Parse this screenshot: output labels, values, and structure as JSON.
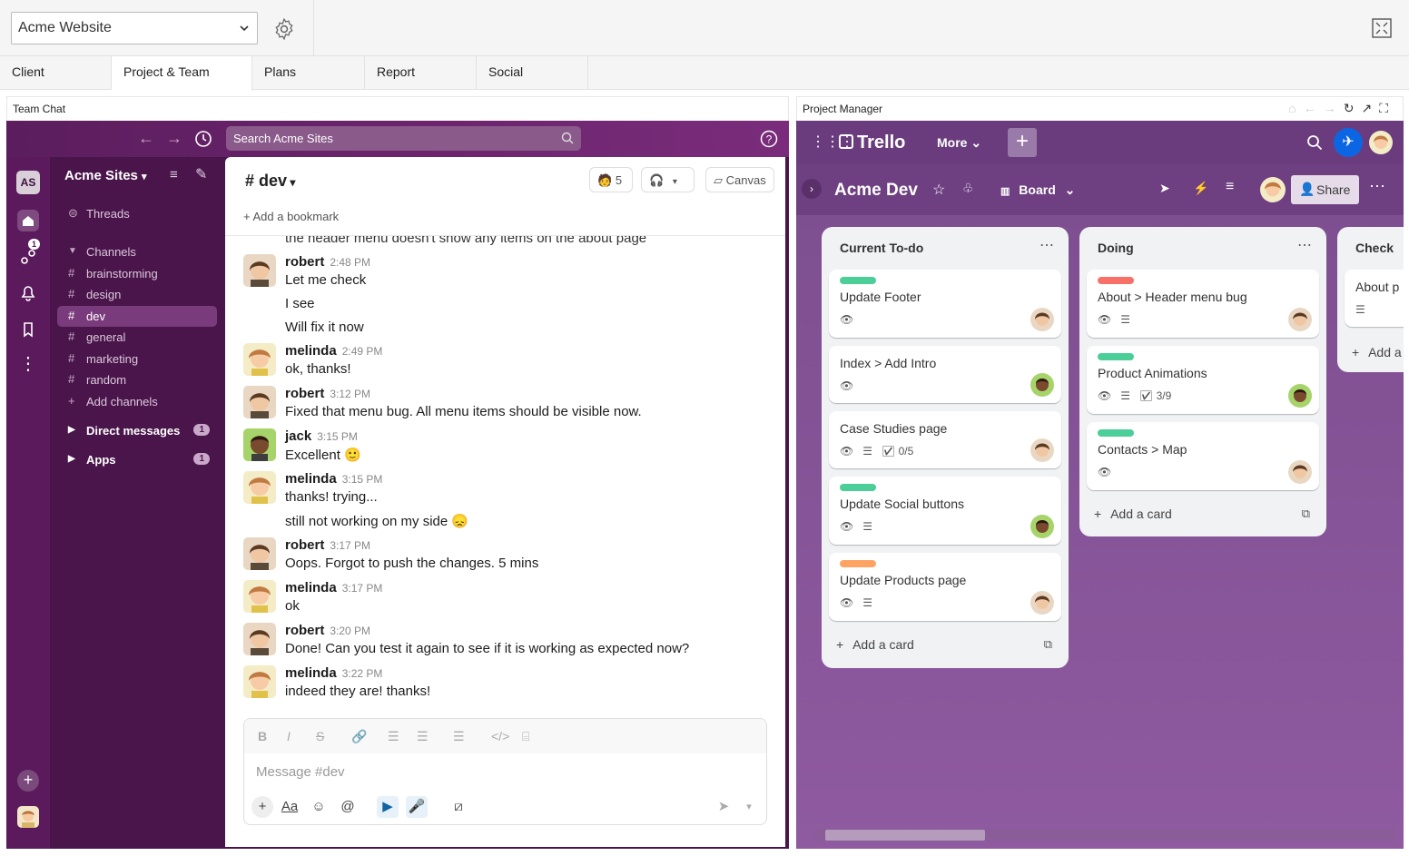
{
  "toolbar": {
    "site": "Acme Website"
  },
  "tabs": [
    "Client",
    "Project & Team",
    "Plans",
    "Report",
    "Social"
  ],
  "panels": {
    "left": "Team Chat",
    "right": "Project Manager"
  },
  "chat": {
    "search_placeholder": "Search Acme Sites",
    "rail": {
      "initials": "AS",
      "activity_badge": "1"
    },
    "workspace": "Acme Sites",
    "threads": "Threads",
    "channels_header": "Channels",
    "channels": [
      "brainstorming",
      "design",
      "dev",
      "general",
      "marketing",
      "random"
    ],
    "add_channels": "Add channels",
    "direct_messages": "Direct messages",
    "dm_badge": "1",
    "apps": "Apps",
    "apps_badge": "1",
    "channel_title": "# dev",
    "member_count": "5",
    "canvas": "Canvas",
    "bookmark": "Add a bookmark",
    "partial_line": "the header menu doesn't show any items on the about page",
    "messages": [
      {
        "user": "robert",
        "time": "2:48 PM",
        "lines": [
          "Let me check",
          "I see",
          "Will fix it now"
        ]
      },
      {
        "user": "melinda",
        "time": "2:49 PM",
        "lines": [
          "ok, thanks!"
        ]
      },
      {
        "user": "robert",
        "time": "3:12 PM",
        "lines": [
          "Fixed that menu bug. All menu items should be visible now."
        ]
      },
      {
        "user": "jack",
        "time": "3:15 PM",
        "lines": [
          "Excellent 🙂"
        ]
      },
      {
        "user": "melinda",
        "time": "3:15 PM",
        "lines": [
          "thanks! trying...",
          "still not working on my side 😞"
        ]
      },
      {
        "user": "robert",
        "time": "3:17 PM",
        "lines": [
          "Oops. Forgot to push the changes. 5 mins"
        ]
      },
      {
        "user": "melinda",
        "time": "3:17 PM",
        "lines": [
          "ok"
        ]
      },
      {
        "user": "robert",
        "time": "3:20 PM",
        "lines": [
          "Done! Can you test it again to see if it is working as expected now?"
        ]
      },
      {
        "user": "melinda",
        "time": "3:22 PM",
        "lines": [
          "indeed they are! thanks!"
        ]
      }
    ],
    "composer_placeholder": "Message #dev",
    "composer_aa": "Aa"
  },
  "trello": {
    "logo": "Trello",
    "more": "More",
    "board_title": "Acme Dev",
    "board_view": "Board",
    "share": "Share",
    "add_card": "Add a card",
    "lists": [
      {
        "title": "Current To-do",
        "cards": [
          {
            "title": "Update Footer",
            "label_color": "#4bce97",
            "meta": ""
          },
          {
            "title": "Index > Add Intro",
            "label_color": "",
            "meta": ""
          },
          {
            "title": "Case Studies page",
            "label_color": "",
            "meta": "0/5"
          },
          {
            "title": "Update Social buttons",
            "label_color": "#4bce97",
            "meta": ""
          },
          {
            "title": "Update Products page",
            "label_color": "#fea362",
            "meta": ""
          }
        ]
      },
      {
        "title": "Doing",
        "cards": [
          {
            "title": "About > Header menu bug",
            "label_color": "#f87168",
            "meta": ""
          },
          {
            "title": "Product Animations",
            "label_color": "#4bce97",
            "meta": "3/9"
          },
          {
            "title": "Contacts > Map",
            "label_color": "#4bce97",
            "meta": ""
          }
        ]
      },
      {
        "title": "Check",
        "cards": [
          {
            "title": "About p",
            "label_color": "",
            "meta": ""
          }
        ],
        "add": "Add a"
      }
    ]
  },
  "colors": {
    "chat_bg": "#4a154b",
    "trello_bg": "#7b4d8e",
    "share_active": "#0c66e4"
  }
}
